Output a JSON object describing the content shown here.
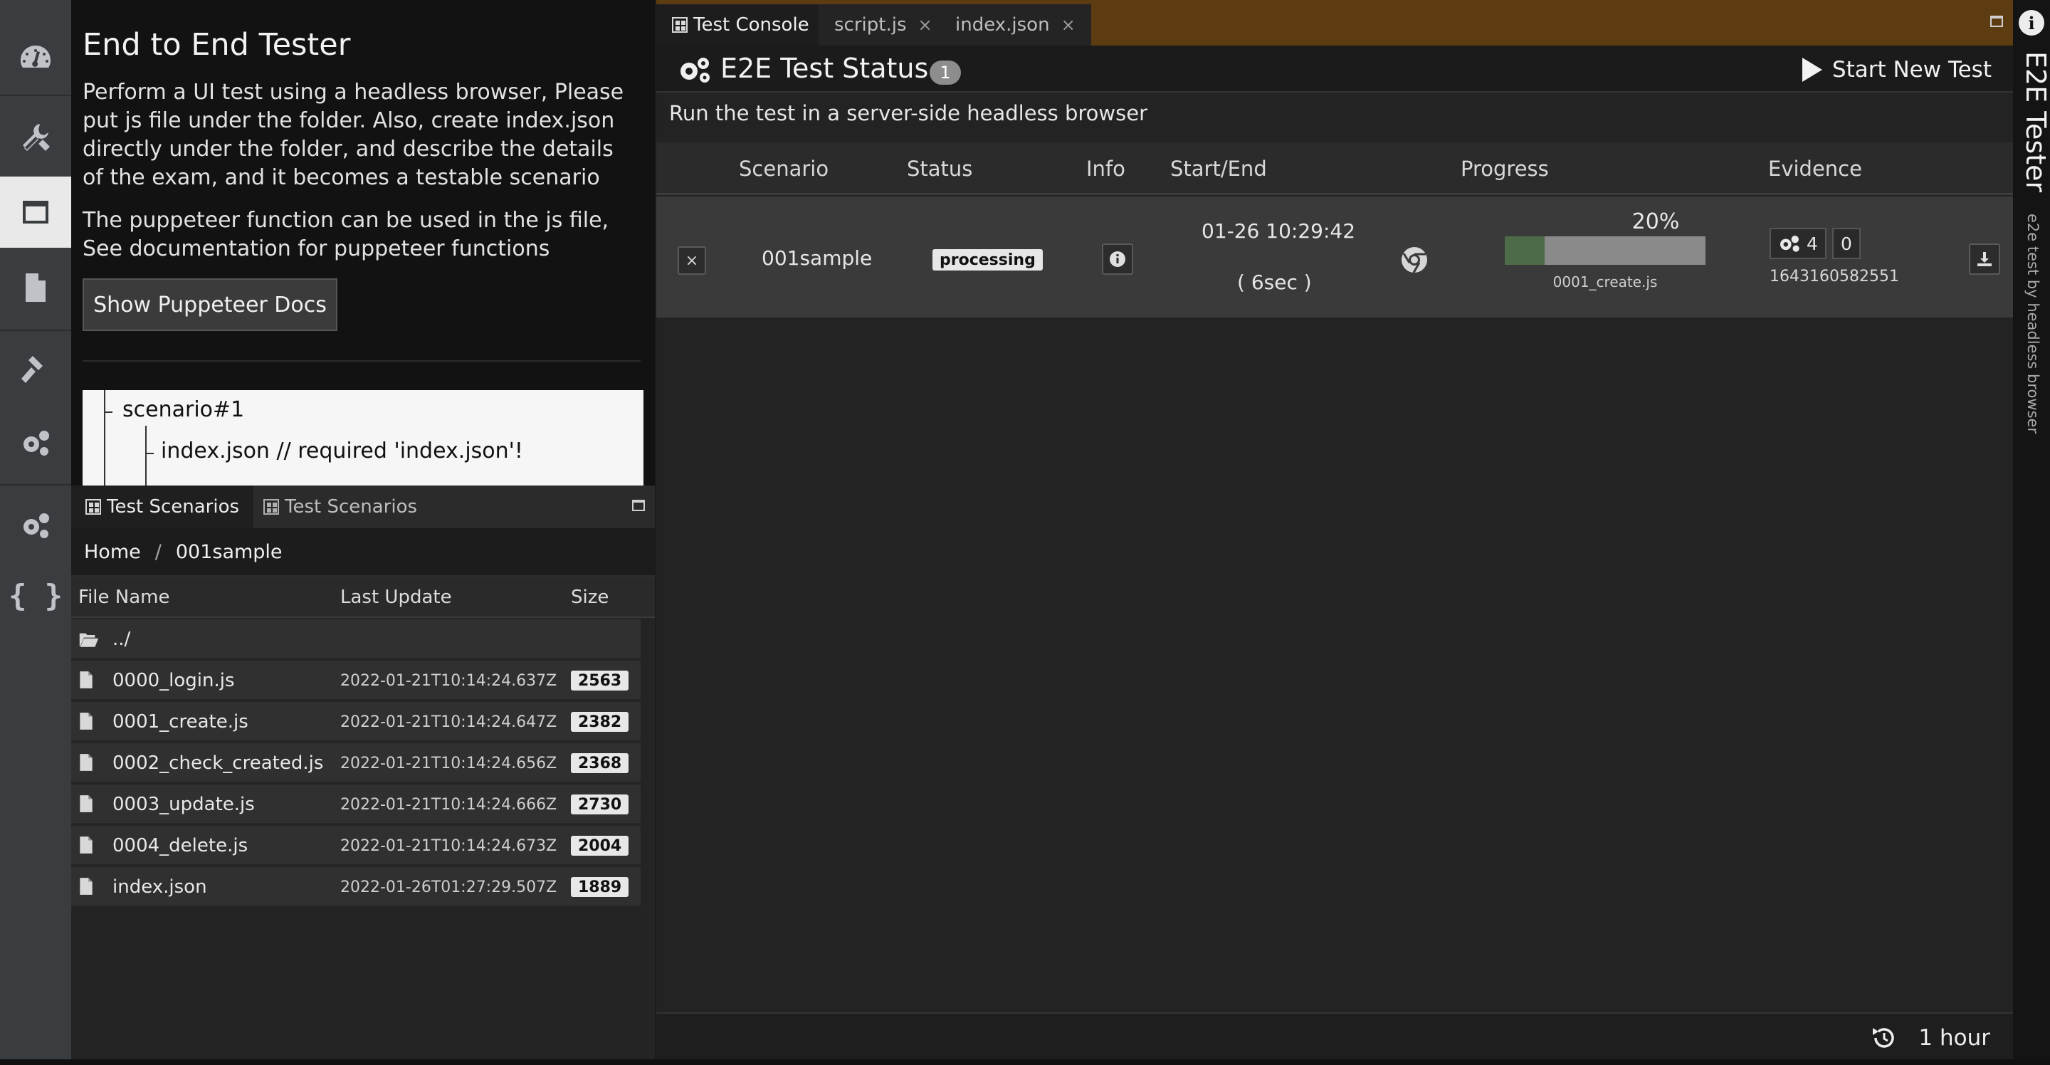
{
  "rail": {
    "icons": [
      "dashboard-icon",
      "tools-icon",
      "window-icon",
      "document-icon",
      "hammer-icon",
      "gears-icon",
      "gears-icon",
      "braces-icon"
    ]
  },
  "info": {
    "title": "End to End Tester",
    "para1": "Perform a UI test using a headless browser, Please put js file under the folder. Also, create index.json directly under the folder, and describe the details of the exam, and it becomes a testable scenario",
    "para2": "The puppeteer function can be used in the js file, See documentation for puppeteer functions",
    "docs_button": "Show Puppeteer Docs",
    "tree": [
      "scenario#1",
      "index.json // required 'index.json'!"
    ]
  },
  "scenarios": {
    "tabs": [
      "Test Scenarios",
      "Test Scenarios"
    ],
    "breadcrumb": {
      "home": "Home",
      "separator": "/",
      "current": "001sample"
    },
    "columns": [
      "File Name",
      "Last Update",
      "Size"
    ],
    "parent": "../",
    "files": [
      {
        "name": "0000_login.js",
        "date": "2022-01-21T10:14:24.637Z",
        "size": "2563"
      },
      {
        "name": "0001_create.js",
        "date": "2022-01-21T10:14:24.647Z",
        "size": "2382"
      },
      {
        "name": "0002_check_created.js",
        "date": "2022-01-21T10:14:24.656Z",
        "size": "2368"
      },
      {
        "name": "0003_update.js",
        "date": "2022-01-21T10:14:24.666Z",
        "size": "2730"
      },
      {
        "name": "0004_delete.js",
        "date": "2022-01-21T10:14:24.673Z",
        "size": "2004"
      },
      {
        "name": "index.json",
        "date": "2022-01-26T01:27:29.507Z",
        "size": "1889"
      }
    ]
  },
  "console": {
    "tabs": [
      {
        "label": "Test Console",
        "closable": false
      },
      {
        "label": "script.js",
        "closable": true
      },
      {
        "label": "index.json",
        "closable": true
      }
    ],
    "close_glyph": "×",
    "status_title": "E2E Test Status",
    "status_count": "1",
    "start_button": "Start New Test",
    "subtitle": "Run the test in a server-side headless browser",
    "columns": [
      "Scenario",
      "Status",
      "Info",
      "Start/End",
      "Progress",
      "Evidence"
    ],
    "row": {
      "cancel_glyph": "×",
      "scenario": "001sample",
      "status": "processing",
      "start": "01-26 10:29:42",
      "duration": "( 6sec )",
      "progress_label": "20%",
      "progress_value": 0.2,
      "progress_step": "0001_create.js",
      "evidence_count": "4",
      "evidence_second": "0",
      "evidence_id": "1643160582551"
    },
    "refresh_label": "1 hour"
  },
  "side": {
    "info_glyph": "i",
    "title": "E2E Tester",
    "subtitle": "e2e test by headless browser"
  },
  "colors": {
    "tab_bar": "#5e3c12",
    "progress_fill": "#4e6b47",
    "progress_track": "#8a8a8a"
  }
}
